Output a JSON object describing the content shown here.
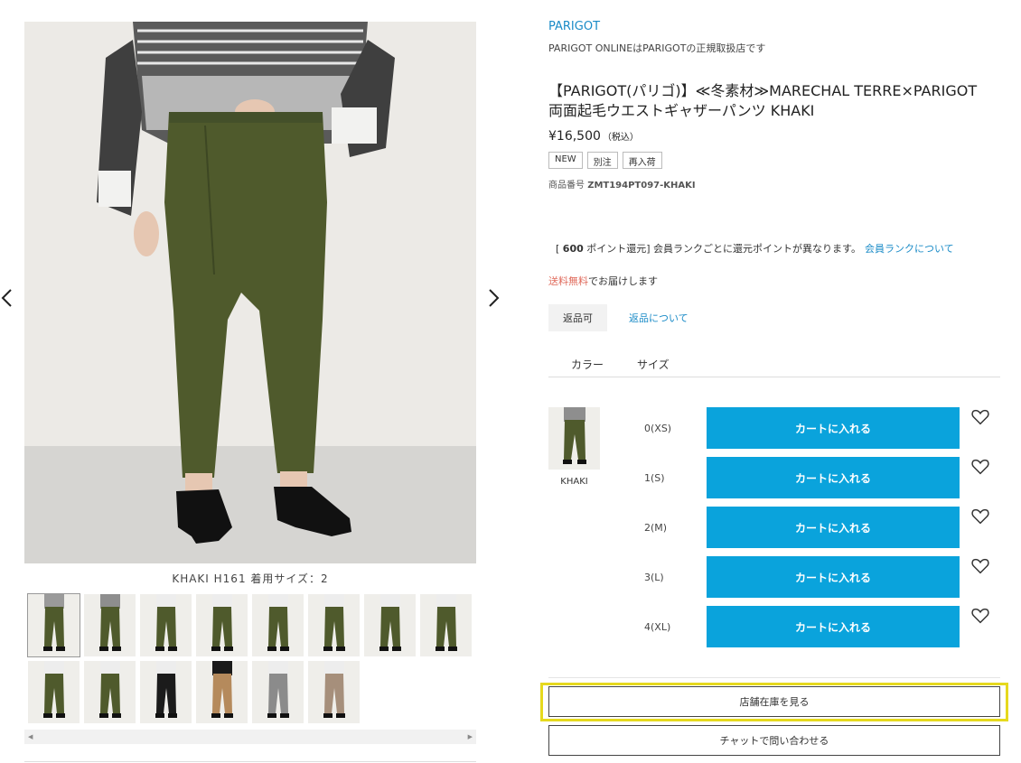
{
  "gallery": {
    "caption": "KHAKI H161 着用サイズ：2",
    "thumbnails": [
      {
        "name": "thumb-khaki-sweater-front",
        "color": "#4f5a2c",
        "top": "#9a9a9a"
      },
      {
        "name": "thumb-khaki-full",
        "color": "#4f5a2c",
        "top": "#8e8e8e"
      },
      {
        "name": "thumb-khaki-side",
        "color": "#4f5a2c",
        "top": "#ededed"
      },
      {
        "name": "thumb-khaki-side2",
        "color": "#4f5a2c",
        "top": "#ededed"
      },
      {
        "name": "thumb-khaki-back",
        "color": "#4f5a2c",
        "top": "#ededed"
      },
      {
        "name": "thumb-khaki-detail",
        "color": "#4f5a2c",
        "top": "#ededed"
      },
      {
        "name": "thumb-khaki-front2",
        "color": "#4f5a2c",
        "top": "#ededed"
      },
      {
        "name": "thumb-khaki-waist",
        "color": "#4f5a2c",
        "top": "#ededed"
      },
      {
        "name": "thumb-khaki-pocket",
        "color": "#4f5a2c",
        "top": "#ededed"
      },
      {
        "name": "thumb-khaki-waist-closeup",
        "color": "#4f5a2c",
        "top": "#ededed"
      },
      {
        "name": "thumb-black",
        "color": "#1b1b1b",
        "top": "#ededed"
      },
      {
        "name": "thumb-camel",
        "color": "#b58a5c",
        "top": "#1a1a1a"
      },
      {
        "name": "thumb-gray",
        "color": "#8b8b8b",
        "top": "#ededed"
      },
      {
        "name": "thumb-beige",
        "color": "#a68f7b",
        "top": "#ededed"
      }
    ]
  },
  "product": {
    "brand": "PARIGOT",
    "dealer": "PARIGOT ONLINEはPARIGOTの正規取扱店です",
    "title": "【PARIGOT(パリゴ)】≪冬素材≫MARECHAL TERRE×PARIGOT 両面起毛ウエストギャザーパンツ KHAKI",
    "price": "¥16,500",
    "tax_label": "（税込）",
    "badges": [
      "NEW",
      "別注",
      "再入荷"
    ],
    "code_label": "商品番号",
    "code": "ZMT194PT097-KHAKI",
    "points_prefix": "[",
    "points_value": "600",
    "points_text": "ポイント還元] 会員ランクごとに還元ポイントが異なります。",
    "points_link": "会員ランクについて",
    "shipping_free": "送料無料",
    "shipping_rest": "でお届けします",
    "return_tag": "返品可",
    "return_link": "返品について"
  },
  "tabs": {
    "color": "カラー",
    "size": "サイズ"
  },
  "color_option": {
    "name": "KHAKI"
  },
  "sizes": [
    {
      "label": "0(XS)",
      "button": "カートに入れる"
    },
    {
      "label": "1(S)",
      "button": "カートに入れる"
    },
    {
      "label": "2(M)",
      "button": "カートに入れる"
    },
    {
      "label": "3(L)",
      "button": "カートに入れる"
    },
    {
      "label": "4(XL)",
      "button": "カートに入れる"
    }
  ],
  "actions": {
    "store_stock": "店舗在庫を見る",
    "chat": "チャットで問い合わせる"
  },
  "colors": {
    "accent": "#0aa3dc",
    "link": "#1a8bc7",
    "highlight": "#e6d91e",
    "shipping_red": "#e06b5c"
  }
}
